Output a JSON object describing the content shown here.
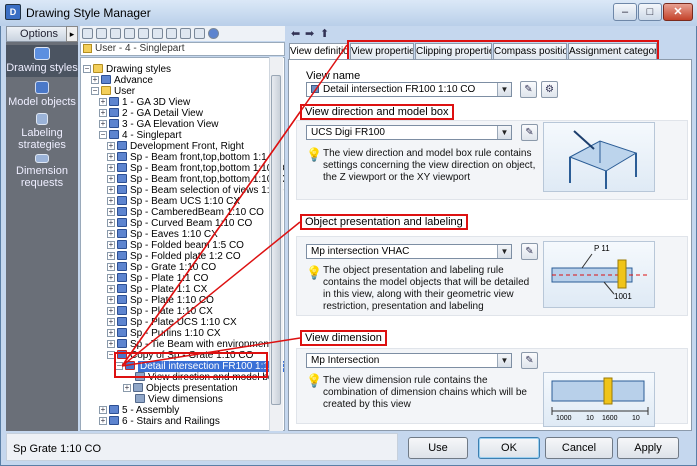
{
  "window": {
    "title": "Drawing Style Manager",
    "controls": [
      "–",
      "□",
      "✕"
    ]
  },
  "left_panel": {
    "options_label": "Options",
    "collapse_glyph": "▸",
    "items": [
      {
        "label": "Drawing styles",
        "icon": "drawing-styles-icon"
      },
      {
        "label": "Model objects",
        "icon": "model-objects-icon"
      },
      {
        "label": "Labeling strategies",
        "icon": "labeling-strategies-icon"
      },
      {
        "label": "Dimension requests",
        "icon": "dimension-requests-icon"
      }
    ]
  },
  "tree": {
    "path": "User - 4 - Singlepart",
    "nodes": [
      {
        "label": "Drawing styles",
        "exp": "−",
        "icon": "folder"
      },
      {
        "label": "Advance",
        "exp": "+",
        "icon": "rule"
      },
      {
        "label": "User",
        "exp": "−",
        "icon": "folder"
      },
      {
        "label": "1 - GA 3D View",
        "exp": "+",
        "icon": "rule"
      },
      {
        "label": "2 - GA Detail View",
        "exp": "+",
        "icon": "rule"
      },
      {
        "label": "3 - GA Elevation View",
        "exp": "+",
        "icon": "rule"
      },
      {
        "label": "4 - Singlepart",
        "exp": "−",
        "icon": "rule"
      },
      {
        "label": "Development Front, Right",
        "exp": "+",
        "icon": "rule"
      },
      {
        "label": "Sp - Beam front,top,bottom 1:1 CX",
        "exp": "+",
        "icon": "rule"
      },
      {
        "label": "Sp - Beam front,top,bottom 1:10 CO",
        "exp": "+",
        "icon": "rule"
      },
      {
        "label": "Sp - Beam front,top,bottom 1:10 CX",
        "exp": "+",
        "icon": "rule"
      },
      {
        "label": "Sp - Beam selection of views 1:10 CX",
        "exp": "+",
        "icon": "rule"
      },
      {
        "label": "Sp - Beam UCS 1:10 CX",
        "exp": "+",
        "icon": "rule"
      },
      {
        "label": "Sp - CamberedBeam 1:10 CO",
        "exp": "+",
        "icon": "rule"
      },
      {
        "label": "Sp - Curved Beam 1:10 CO",
        "exp": "+",
        "icon": "rule"
      },
      {
        "label": "Sp - Eaves 1:10 CX",
        "exp": "+",
        "icon": "rule"
      },
      {
        "label": "Sp - Folded beam 1:5 CO",
        "exp": "+",
        "icon": "rule"
      },
      {
        "label": "Sp - Folded plate 1:2 CO",
        "exp": "+",
        "icon": "rule"
      },
      {
        "label": "Sp - Grate 1:10 CO",
        "exp": "+",
        "icon": "rule"
      },
      {
        "label": "Sp - Plate 1:1 CO",
        "exp": "+",
        "icon": "rule"
      },
      {
        "label": "Sp - Plate 1:1 CX",
        "exp": "+",
        "icon": "rule"
      },
      {
        "label": "Sp - Plate 1:10 CO",
        "exp": "+",
        "icon": "rule"
      },
      {
        "label": "Sp - Plate 1:10 CX",
        "exp": "+",
        "icon": "rule"
      },
      {
        "label": "Sp - Plate UCS 1:10 CX",
        "exp": "+",
        "icon": "rule"
      },
      {
        "label": "Sp - Purlins 1:10 CX",
        "exp": "+",
        "icon": "rule"
      },
      {
        "label": "Sp - Tie Beam with environment",
        "exp": "+",
        "icon": "rule"
      },
      {
        "label": "Copy of Sp - Grate 1:10 CO",
        "exp": "−",
        "icon": "red"
      },
      {
        "label": "Detail intersection FR100 1:10 CO",
        "exp": "−",
        "icon": "red",
        "selected": true
      },
      {
        "label": "View direction and model box",
        "exp": "",
        "icon": "item"
      },
      {
        "label": "Objects presentation",
        "exp": "+",
        "icon": "item"
      },
      {
        "label": "View dimensions",
        "exp": "",
        "icon": "item"
      },
      {
        "label": "5 - Assembly",
        "exp": "+",
        "icon": "rule"
      },
      {
        "label": "6 - Stairs and Railings",
        "exp": "+",
        "icon": "rule"
      }
    ]
  },
  "tabs": [
    "View definition",
    "View properties",
    "Clipping properties",
    "Compass position",
    "Assignment categories"
  ],
  "view_definition": {
    "view_name_label": "View name",
    "view_name_value": "Detail intersection FR100 1:10 CO",
    "callouts": {
      "direction": "View direction and model box",
      "presentation": "Object presentation and labeling",
      "dimension": "View dimension"
    },
    "direction": {
      "combo": "UCS Digi FR100",
      "description": "The view direction and model box rule contains settings concerning the view direction on object, the Z viewport or the XY viewport"
    },
    "presentation": {
      "combo": "Mp intersection VHAC",
      "description": "The object presentation and labeling rule contains the model objects that will be detailed in this view, along with their geometric view restriction, presentation and labeling",
      "preview_labels": [
        "P 11",
        "1001"
      ]
    },
    "dimension": {
      "combo": "Mp Intersection",
      "description": "The view dimension rule contains the combination of dimension chains which will be created by this view",
      "preview_labels": [
        "1000",
        "10",
        "1600",
        "10"
      ]
    }
  },
  "status": {
    "text": "Sp Grate 1:10 CO"
  },
  "buttons": {
    "use": "Use",
    "ok": "OK",
    "cancel": "Cancel",
    "apply": "Apply"
  },
  "colors": {
    "highlight": "#d11111",
    "selection": "#3a70d6",
    "nav_bg": "#6a6f78"
  }
}
